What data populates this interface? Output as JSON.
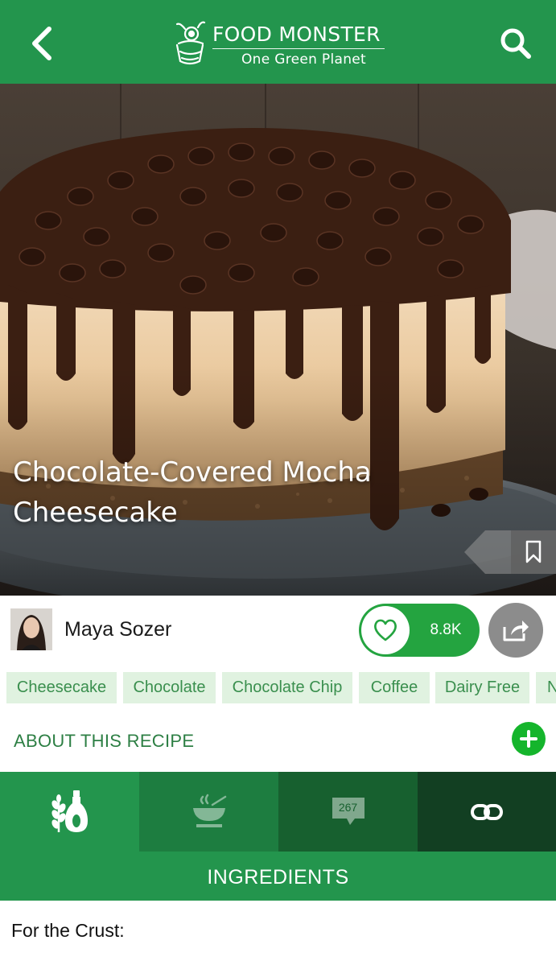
{
  "header": {
    "brand_title": "FOOD MONSTER",
    "brand_subtitle": "One Green Planet",
    "back_icon": "chevron-left-icon",
    "search_icon": "search-icon"
  },
  "recipe": {
    "title": "Chocolate-Covered Mocha Cheesecake",
    "image_alt": "Chocolate-covered mocha cheesecake topped with chocolate chips"
  },
  "author": {
    "name": "Maya Sozer",
    "likes": "8.8K"
  },
  "tags": [
    "Cheesecake",
    "Chocolate",
    "Chocolate Chip",
    "Coffee",
    "Dairy Free",
    "N"
  ],
  "about": {
    "label": "ABOUT THIS RECIPE"
  },
  "tabs": {
    "ingredients_icon": "ingredients-icon",
    "preparation_icon": "bowl-icon",
    "comments_count": "267",
    "links_icon": "link-icon"
  },
  "section": {
    "title": "INGREDIENTS",
    "subheading": "For the Crust:"
  },
  "colors": {
    "brand_green": "#23954d",
    "tag_bg": "#e0f2e0",
    "tag_text": "#3a8f4e",
    "like_green": "#24a440"
  }
}
